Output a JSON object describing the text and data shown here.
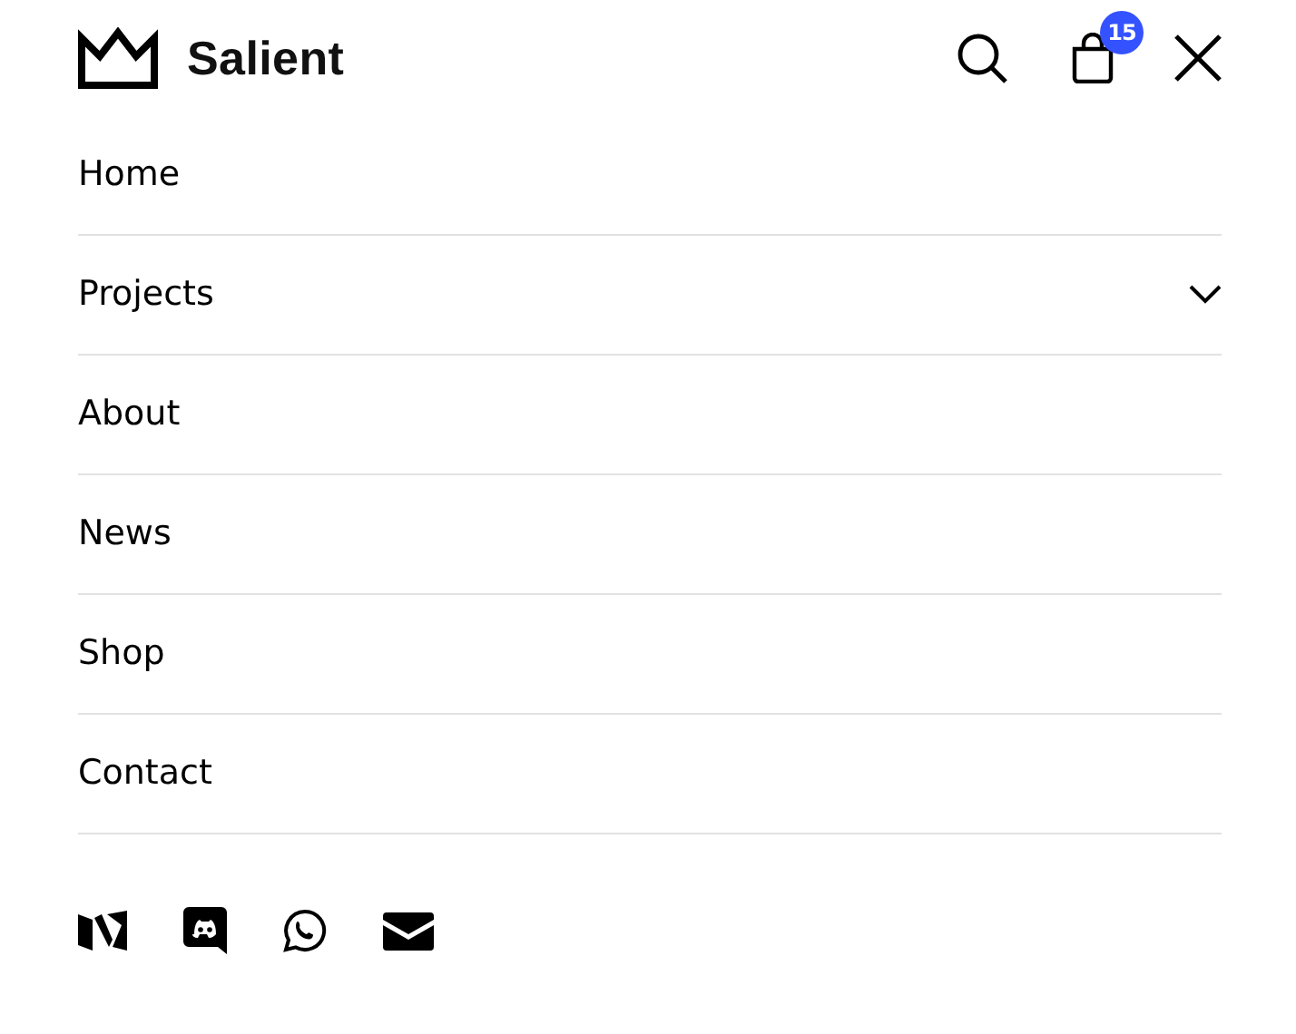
{
  "header": {
    "brand": "Salient",
    "cart_count": "15"
  },
  "menu": [
    {
      "label": "Home",
      "has_submenu": false
    },
    {
      "label": "Projects",
      "has_submenu": true
    },
    {
      "label": "About",
      "has_submenu": false
    },
    {
      "label": "News",
      "has_submenu": false
    },
    {
      "label": "Shop",
      "has_submenu": false
    },
    {
      "label": "Contact",
      "has_submenu": false
    }
  ]
}
